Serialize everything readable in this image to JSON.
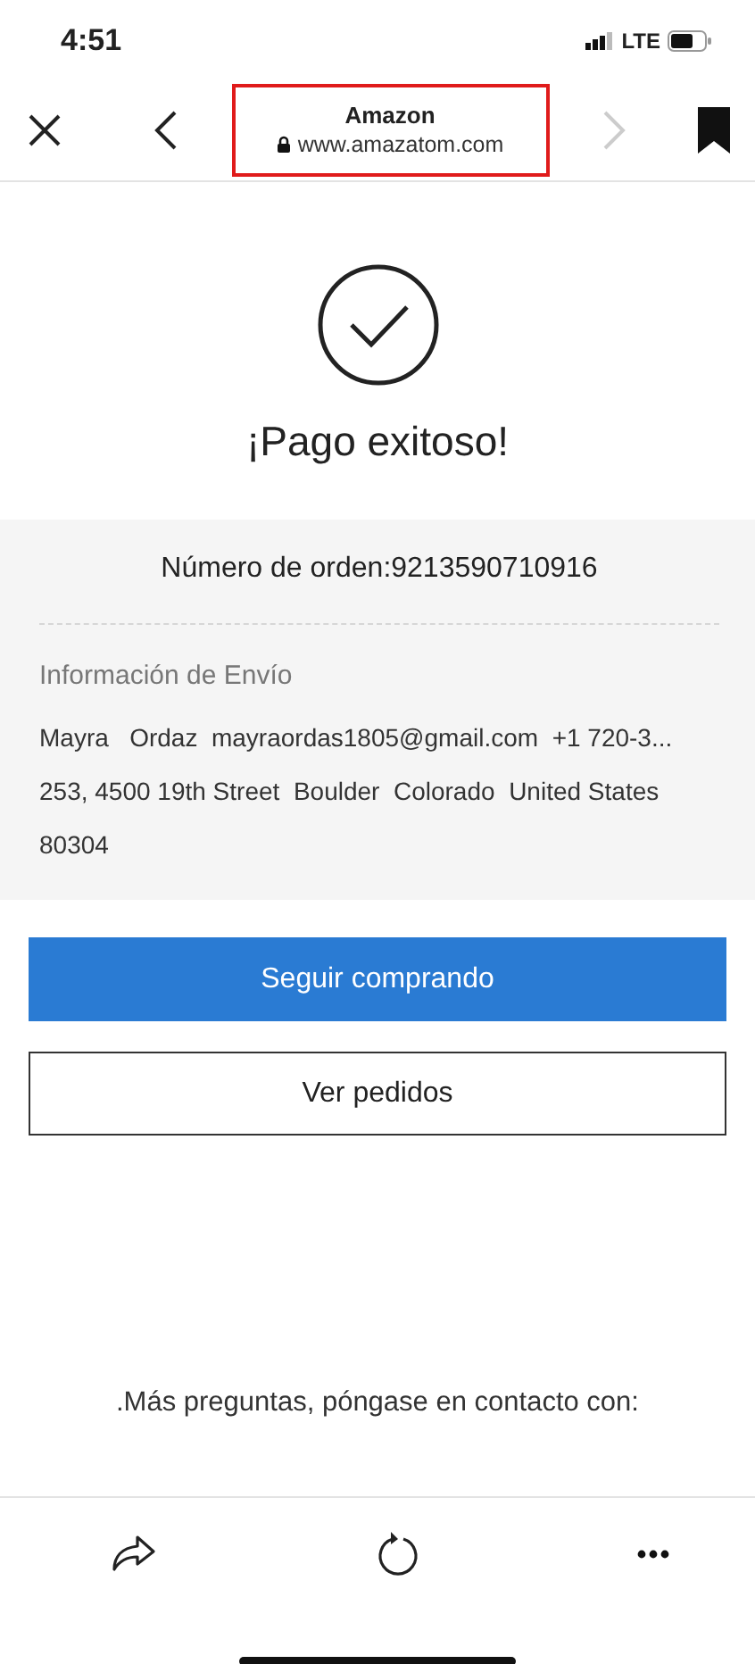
{
  "status_bar": {
    "time": "4:51",
    "network": "LTE"
  },
  "toolbar": {
    "title": "Amazon",
    "url": "www.amazatom.com",
    "url_highlighted": true,
    "forward_disabled": true
  },
  "success": {
    "title": "¡Pago exitoso!"
  },
  "order": {
    "number": "Número de orden:9213590710916",
    "shipping_heading": "Información de Envío",
    "shipping_lines": [
      "Mayra   Ordaz  mayraordas1805@gmail.com  +1 720-3...",
      "253, 4500 19th Street  Boulder  Colorado  United States",
      "80304"
    ]
  },
  "buttons": [
    {
      "label": "Seguir comprando",
      "kind": "primary"
    },
    {
      "label": "Ver pedidos",
      "kind": "outline"
    }
  ],
  "contact_text": ".Más preguntas, póngase en contacto con:"
}
